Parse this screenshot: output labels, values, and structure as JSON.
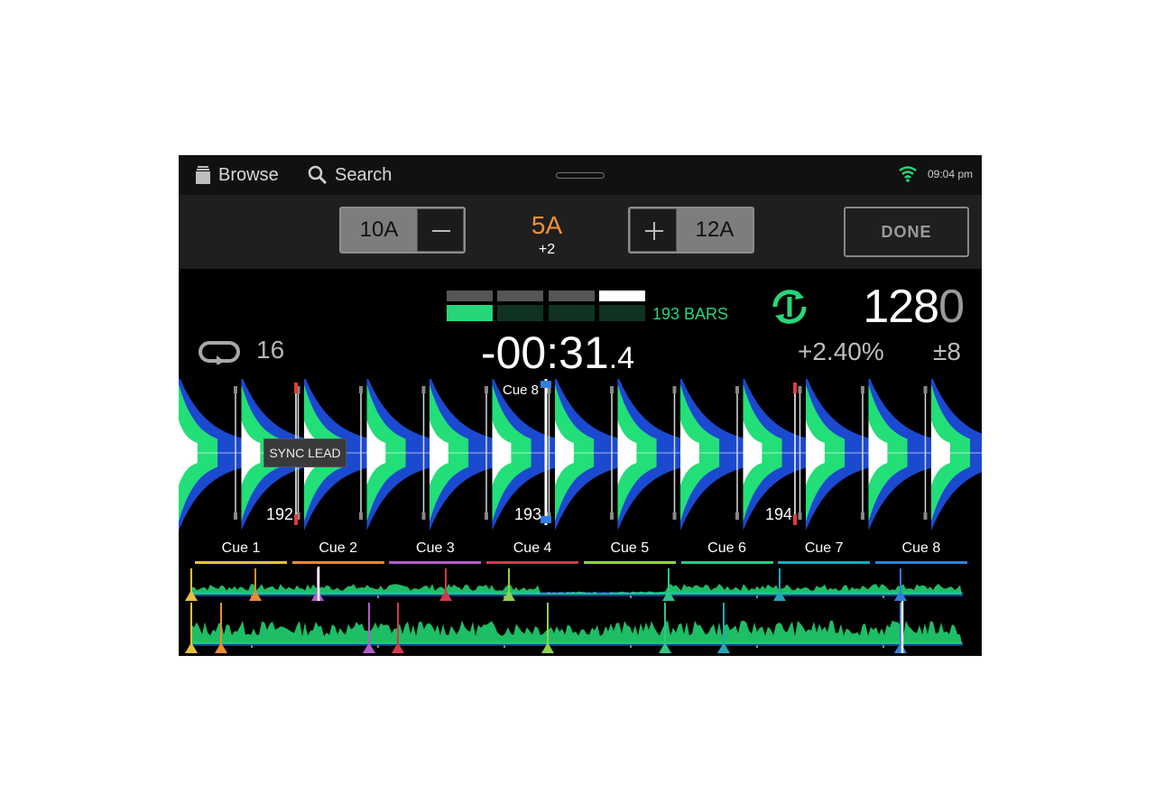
{
  "topbar": {
    "browse_label": "Browse",
    "search_label": "Search",
    "time": "09:04 pm",
    "icons": [
      "browse-icon",
      "search-icon",
      "wifi-icon"
    ]
  },
  "keybar": {
    "key_down": "10A",
    "key_up": "12A",
    "current_key": "5A",
    "key_offset": "+2",
    "done_label": "DONE"
  },
  "deck": {
    "bars_label": "193 BARS",
    "bpm_main": "128",
    "bpm_decimal": "0",
    "loop_length": "16",
    "remaining_main": "-00:31",
    "remaining_decimal": ".4",
    "pitch": "+2.40%",
    "pitch_range": "±8",
    "sync_lead_label": "SYNC LEAD",
    "cue_flag_label": "Cue 8",
    "beat_numbers": [
      "192",
      "193",
      "194"
    ]
  },
  "cues": [
    {
      "label": "Cue 1",
      "color": "#e6c13a"
    },
    {
      "label": "Cue 2",
      "color": "#ef8a33"
    },
    {
      "label": "Cue 3",
      "color": "#b35ad1"
    },
    {
      "label": "Cue 4",
      "color": "#d8364a"
    },
    {
      "label": "Cue 5",
      "color": "#8fd14a"
    },
    {
      "label": "Cue 6",
      "color": "#2cc784"
    },
    {
      "label": "Cue 7",
      "color": "#1fa7b8"
    },
    {
      "label": "Cue 8",
      "color": "#2f7fe0"
    }
  ],
  "colors": {
    "accent_green": "#27d67a",
    "key_orange": "#f0923a",
    "wave_blue": "#1b49cf",
    "wave_green": "#22df77"
  }
}
